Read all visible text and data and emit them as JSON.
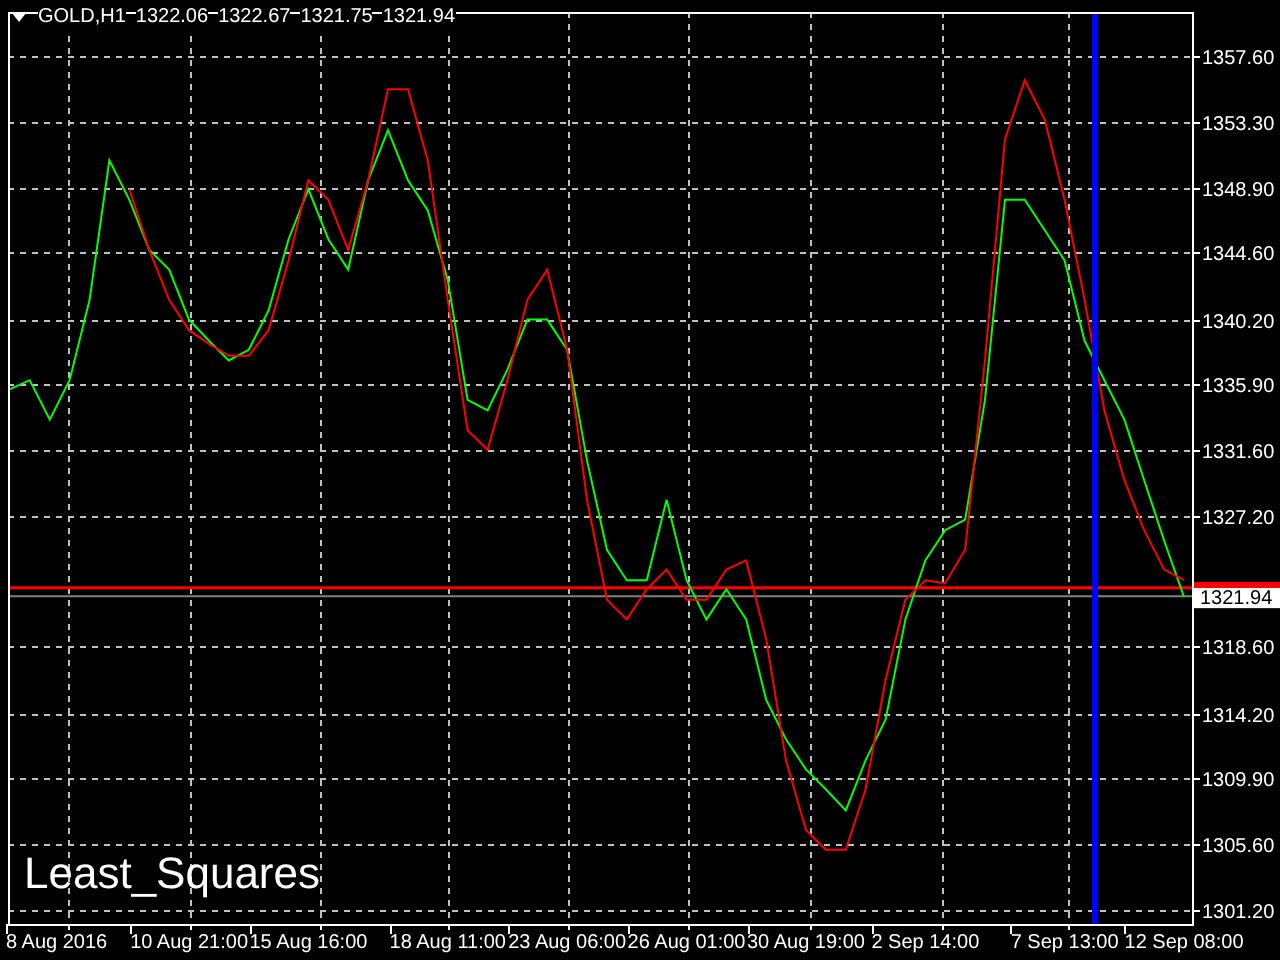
{
  "header": {
    "symbol": "GOLD,H1",
    "quotes": [
      "1322.06",
      "1322.67",
      "1321.75",
      "1321.94"
    ]
  },
  "indicator_label": "Least_Squares",
  "marker_line": {
    "color": "#0000ff"
  },
  "chart_data": {
    "type": "line",
    "grid": true,
    "ylim": [
      1300.3,
      1360.5
    ],
    "categories": [
      null,
      null,
      "8 Aug 2016",
      null,
      null,
      null,
      null,
      null,
      null,
      "10 Aug 21:00",
      null,
      null,
      null,
      null,
      null,
      "15 Aug 16:00",
      null,
      null,
      null,
      null,
      null,
      null,
      "18 Aug 11:00",
      null,
      null,
      null,
      null,
      null,
      "23 Aug 06:00",
      null,
      null,
      null,
      null,
      null,
      "26 Aug 01:00",
      null,
      null,
      null,
      null,
      null,
      "30 Aug 19:00",
      null,
      null,
      null,
      null,
      null,
      "2 Sep 14:00",
      null,
      null,
      null,
      null,
      null,
      null,
      "7 Sep 13:00",
      null,
      null,
      null,
      null,
      null,
      "12 Sep 08:00"
    ],
    "yticks": [
      {
        "value": 1357.6,
        "label": "1357.60"
      },
      {
        "value": 1353.3,
        "label": "1353.30"
      },
      {
        "value": 1348.9,
        "label": "1348.90"
      },
      {
        "value": 1344.6,
        "label": "1344.60"
      },
      {
        "value": 1340.2,
        "label": "1340.20"
      },
      {
        "value": 1335.9,
        "label": "1335.90"
      },
      {
        "value": 1331.6,
        "label": "1331.60"
      },
      {
        "value": 1327.2,
        "label": "1327.20"
      },
      {
        "value": 1318.6,
        "label": "1318.60"
      },
      {
        "value": 1314.2,
        "label": "1314.20"
      },
      {
        "value": 1309.9,
        "label": "1309.90"
      },
      {
        "value": 1305.6,
        "label": "1305.60"
      },
      {
        "value": 1301.2,
        "label": "1301.20"
      }
    ],
    "series": [
      {
        "color": "#00ff00",
        "values": [
          1335.6,
          1336.2,
          1333.6,
          1336.2,
          1341.5,
          1350.7,
          1348.1,
          1344.8,
          1343.5,
          1340.2,
          1338.8,
          1337.5,
          1338.2,
          1340.8,
          1345.5,
          1348.8,
          1345.5,
          1343.5,
          1349.4,
          1352.7,
          1349.4,
          1347.4,
          1342.8,
          1334.9,
          1334.2,
          1336.9,
          1340.2,
          1340.2,
          1338.2,
          1330.9,
          1325.0,
          1323.0,
          1323.0,
          1328.3,
          1323.0,
          1320.4,
          1322.4,
          1320.4,
          1315.1,
          1312.5,
          1310.5,
          1309.2,
          1307.8,
          1311.1,
          1313.8,
          1320.4,
          1324.3,
          1326.3,
          1327.0,
          1334.9,
          1348.1,
          1348.1,
          1346.1,
          1344.1,
          1338.8,
          1336.2,
          1333.6,
          1329.6,
          1325.6,
          1321.9
        ]
      },
      {
        "color": "#ff0000",
        "values": [
          null,
          null,
          null,
          null,
          null,
          null,
          1348.8,
          1344.8,
          1341.5,
          1339.5,
          1338.6,
          1337.8,
          1337.8,
          1339.5,
          1344.1,
          1349.4,
          1348.1,
          1344.8,
          1349.4,
          1355.4,
          1355.4,
          1350.7,
          1341.5,
          1332.9,
          1331.6,
          1336.2,
          1341.5,
          1343.5,
          1338.2,
          1328.3,
          1321.7,
          1320.4,
          1322.4,
          1323.7,
          1321.7,
          1321.7,
          1323.7,
          1324.3,
          1319.1,
          1311.1,
          1306.5,
          1305.2,
          1305.2,
          1309.2,
          1316.4,
          1321.7,
          1323.0,
          1322.8,
          1325.0,
          1337.5,
          1352.1,
          1356.0,
          1353.4,
          1348.1,
          1341.5,
          1334.2,
          1329.6,
          1326.3,
          1323.7,
          1323.0
        ]
      }
    ],
    "ref_lines": [
      {
        "axis": "y",
        "value": 1322.5,
        "color": "#ff0000"
      },
      {
        "axis": "y",
        "value": 1321.94,
        "color": "#808080",
        "label": "1321.94"
      }
    ]
  }
}
